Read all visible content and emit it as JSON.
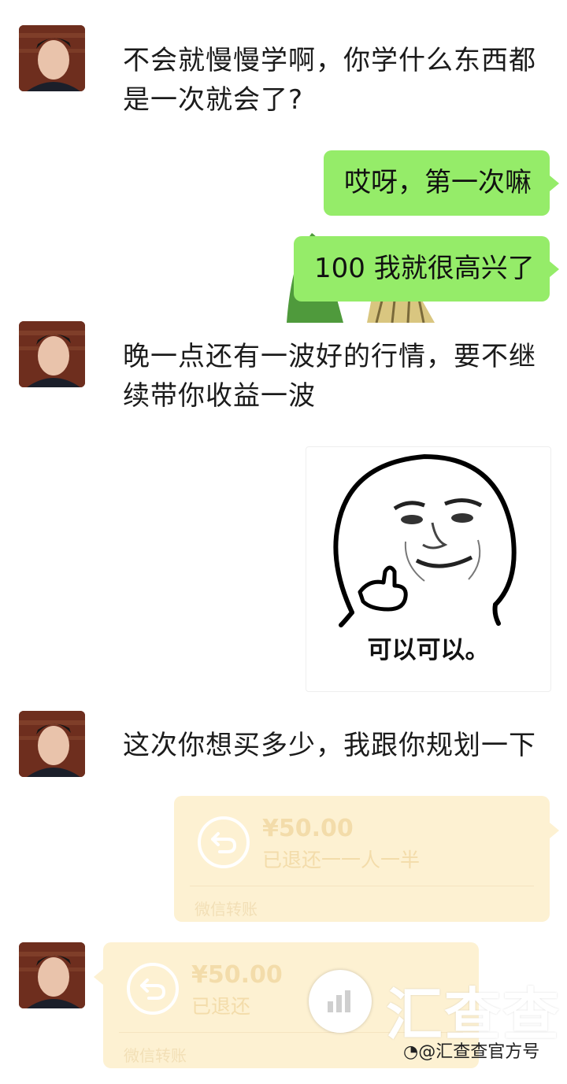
{
  "messages": {
    "m1": {
      "text_line1": "不会就慢慢学啊，你学什么东西都",
      "text_line2": "是一次就会了?"
    },
    "m2": {
      "text": "哎呀，第一次嘛"
    },
    "m3": {
      "text": "100 我就很高兴了"
    },
    "m4": {
      "text_line1": "晚一点还有一波好的行情，要不继",
      "text_line2": "续带你收益一波"
    },
    "m5": {
      "caption": "可以可以。"
    },
    "m6": {
      "text": "这次你想买多少，我跟你规划一下"
    },
    "m7": {
      "amount": "¥50.00",
      "status": "已退还一一人一半",
      "footer": "微信转账"
    },
    "m8": {
      "amount": "¥50.00",
      "status": "已退还",
      "footer": "微信转账"
    }
  },
  "watermark": {
    "logo_text": "汇查查",
    "credit": "@汇查查官方号"
  },
  "colors": {
    "sent_bubble": "#95ec69",
    "transfer_bg": "#fdf1d2",
    "page_bg": "#ffffff"
  }
}
